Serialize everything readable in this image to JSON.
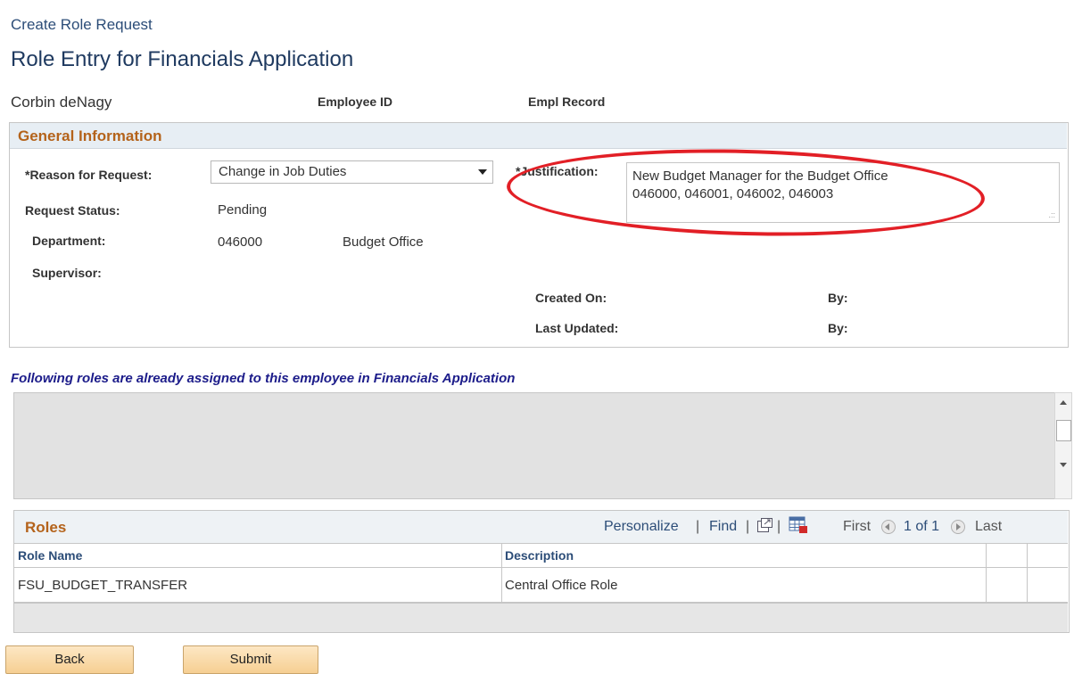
{
  "breadcrumb": "Create Role Request",
  "page_title": "Role Entry for Financials Application",
  "employee": {
    "name": "Corbin deNagy",
    "employee_id_label": "Employee ID",
    "empl_record_label": "Empl Record"
  },
  "general_info": {
    "heading": "General Information",
    "reason_label": "*Reason for Request:",
    "reason_value": "Change in Job Duties",
    "status_label": "Request Status:",
    "status_value": "Pending",
    "department_label": "Department:",
    "department_code": "046000",
    "department_name": "Budget Office",
    "supervisor_label": "Supervisor:",
    "justification_label": "*Justification:",
    "justification_lines": [
      "New Budget Manager for the Budget Office",
      "046000, 046001, 046002, 046003"
    ],
    "created_on_label": "Created On:",
    "last_updated_label": "Last Updated:",
    "by_label": "By:",
    "annotation_color": "#e21f26"
  },
  "assigned_roles_heading": "Following roles are already assigned to this employee in Financials Application",
  "roles_grid": {
    "title": "Roles",
    "personalize": "Personalize",
    "find": "Find",
    "separator": "|",
    "first": "First",
    "page_info": "1 of 1",
    "last": "Last",
    "columns": [
      "Role Name",
      "Description"
    ],
    "rows": [
      {
        "role_name": "FSU_BUDGET_TRANSFER",
        "description": "Central Office Role"
      }
    ]
  },
  "buttons": {
    "back": "Back",
    "submit": "Submit"
  },
  "icons": {
    "view_all": "new-window-icon",
    "download": "spreadsheet-download-icon",
    "dropdown": "chevron-down-icon"
  }
}
